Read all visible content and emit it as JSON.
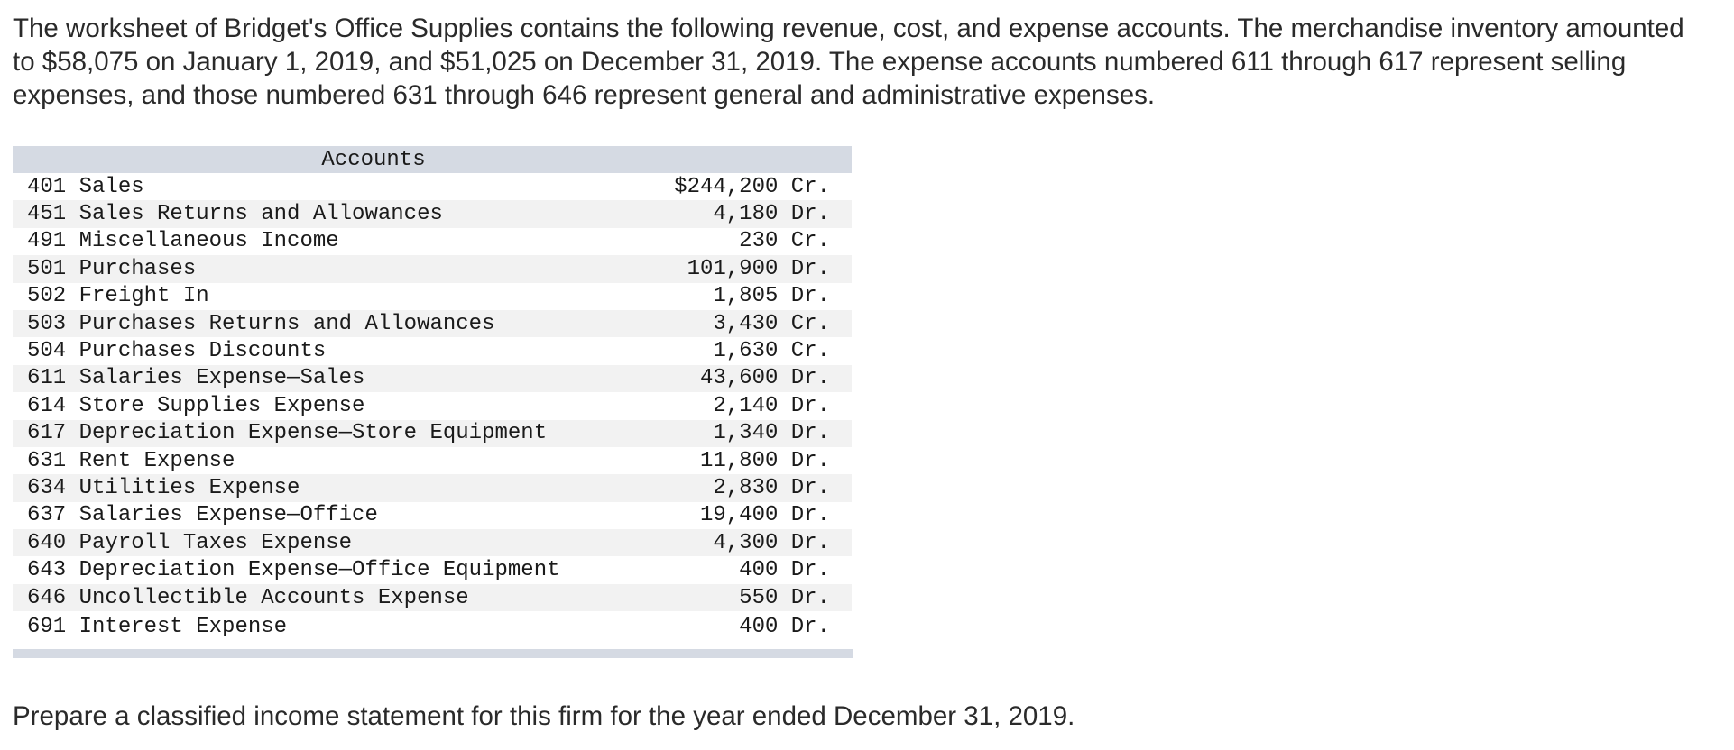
{
  "intro_text": "The worksheet of Bridget's Office Supplies contains the following revenue, cost, and expense accounts. The merchandise inventory amounted to $58,075 on January 1, 2019, and $51,025 on December 31, 2019. The expense accounts numbered 611 through 617 represent selling expenses, and those numbered 631 through 646 represent general and administrative expenses.",
  "table": {
    "header": "Accounts",
    "rows": [
      {
        "account": "401 Sales",
        "amount": "$244,200 Cr."
      },
      {
        "account": "451 Sales Returns and Allowances",
        "amount": "4,180 Dr."
      },
      {
        "account": "491 Miscellaneous Income",
        "amount": "230 Cr."
      },
      {
        "account": "501 Purchases",
        "amount": "101,900 Dr."
      },
      {
        "account": "502 Freight In",
        "amount": "1,805 Dr."
      },
      {
        "account": "503 Purchases Returns and Allowances",
        "amount": "3,430 Cr."
      },
      {
        "account": "504 Purchases Discounts",
        "amount": "1,630 Cr."
      },
      {
        "account": "611 Salaries Expense—Sales",
        "amount": "43,600 Dr."
      },
      {
        "account": "614 Store Supplies Expense",
        "amount": "2,140 Dr."
      },
      {
        "account": "617 Depreciation Expense—Store Equipment",
        "amount": "1,340 Dr."
      },
      {
        "account": "631 Rent Expense",
        "amount": "11,800 Dr."
      },
      {
        "account": "634 Utilities Expense",
        "amount": "2,830 Dr."
      },
      {
        "account": "637 Salaries Expense—Office",
        "amount": "19,400 Dr."
      },
      {
        "account": "640 Payroll Taxes Expense",
        "amount": "4,300 Dr."
      },
      {
        "account": "643 Depreciation Expense—Office Equipment",
        "amount": "400 Dr."
      },
      {
        "account": "646 Uncollectible Accounts Expense",
        "amount": "550 Dr."
      },
      {
        "account": "691 Interest Expense",
        "amount": "400 Dr."
      }
    ]
  },
  "prompt_text": "Prepare a classified income statement for this firm for the year ended December 31, 2019.",
  "colors": {
    "header_bg": "#d5dae3",
    "row_alt_bg": "#f2f2f2",
    "text": "#2a2a2a"
  }
}
